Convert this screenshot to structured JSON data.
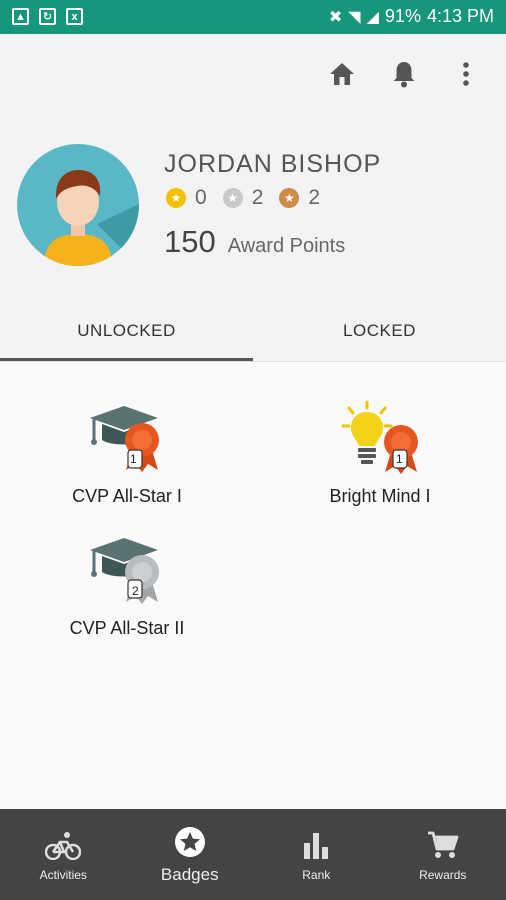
{
  "status_bar": {
    "battery": "91%",
    "time": "4:13 PM"
  },
  "profile": {
    "name": "JORDAN BISHOP",
    "medals": [
      {
        "icon": "gold-medal-icon",
        "color": "#f2c200",
        "count": "0"
      },
      {
        "icon": "silver-medal-icon",
        "color": "#c9c9c9",
        "count": "2"
      },
      {
        "icon": "bronze-medal-icon",
        "color": "#d08a4a",
        "count": "2"
      }
    ],
    "points": "150",
    "points_label": "Award Points"
  },
  "tabs": [
    {
      "label": "UNLOCKED",
      "active": true
    },
    {
      "label": "LOCKED",
      "active": false
    }
  ],
  "badges": [
    {
      "label": "CVP All-Star I",
      "icon": "graduation-cap-icon",
      "ribbon": "1",
      "ribbon_color": "#e8561f"
    },
    {
      "label": "Bright Mind I",
      "icon": "lightbulb-icon",
      "ribbon": "1",
      "ribbon_color": "#e8561f"
    },
    {
      "label": "CVP All-Star II",
      "icon": "graduation-cap-icon",
      "ribbon": "2",
      "ribbon_color": "#b9bcbe"
    }
  ],
  "nav": [
    {
      "label": "Activities",
      "icon": "bicycle-icon"
    },
    {
      "label": "Badges",
      "icon": "star-badge-icon",
      "active": true
    },
    {
      "label": "Rank",
      "icon": "bar-chart-icon"
    },
    {
      "label": "Rewards",
      "icon": "cart-icon"
    }
  ],
  "colors": {
    "status_bar": "#16967a",
    "bottom_nav": "#444444",
    "avatar_bg": "#5ab8c6"
  }
}
